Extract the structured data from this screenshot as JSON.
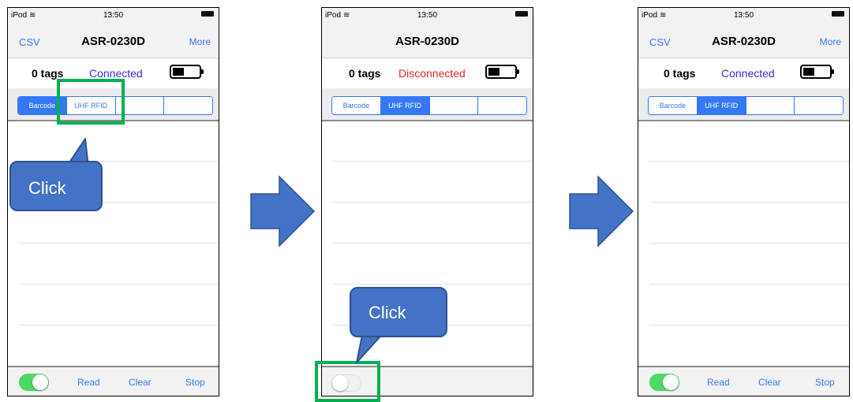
{
  "panels": [
    {
      "status": {
        "carrier": "iPod",
        "time": "13:50"
      },
      "nav": {
        "left": "CSV",
        "title": "ASR-0230D",
        "right": "More"
      },
      "info": {
        "tags": "0 tags",
        "connection": "Connected"
      },
      "segments": [
        "Barcode",
        "UHF RFID",
        "",
        ""
      ],
      "selected_segment": 1,
      "toggle_on": true,
      "toolbar": {
        "read": "Read",
        "clear": "Clear",
        "stop": "Stop"
      }
    },
    {
      "status": {
        "carrier": "iPod",
        "time": "13:50"
      },
      "nav": {
        "left": "",
        "title": "ASR-0230D",
        "right": ""
      },
      "info": {
        "tags": "0 tags",
        "connection": "Disconnected"
      },
      "segments": [
        "Barcode",
        "UHF RFID",
        "",
        ""
      ],
      "selected_segment": 1,
      "toggle_on": false,
      "toolbar": {
        "read": "",
        "clear": "",
        "stop": ""
      }
    },
    {
      "status": {
        "carrier": "iPod",
        "time": "13:50"
      },
      "nav": {
        "left": "CSV",
        "title": "ASR-0230D",
        "right": "More"
      },
      "info": {
        "tags": "0 tags",
        "connection": "Connected"
      },
      "segments": [
        "Barcode",
        "UHF RFID",
        "",
        ""
      ],
      "selected_segment": 1,
      "toggle_on": true,
      "toolbar": {
        "read": "Read",
        "clear": "Clear",
        "stop": "Stop"
      }
    }
  ],
  "annotations": {
    "callout_1": "Click",
    "callout_2": "Click"
  },
  "colors": {
    "accent_blue": "#3478f6",
    "connected": "#3a2bd9",
    "disconnected": "#ee2222",
    "toggle_on": "#4cd964",
    "callout_fill": "#4472c4",
    "arrow_fill": "#4472c4",
    "highlight": "#00b050"
  },
  "icons": [
    "wifi-icon",
    "battery-icon",
    "arrow-right-icon"
  ]
}
